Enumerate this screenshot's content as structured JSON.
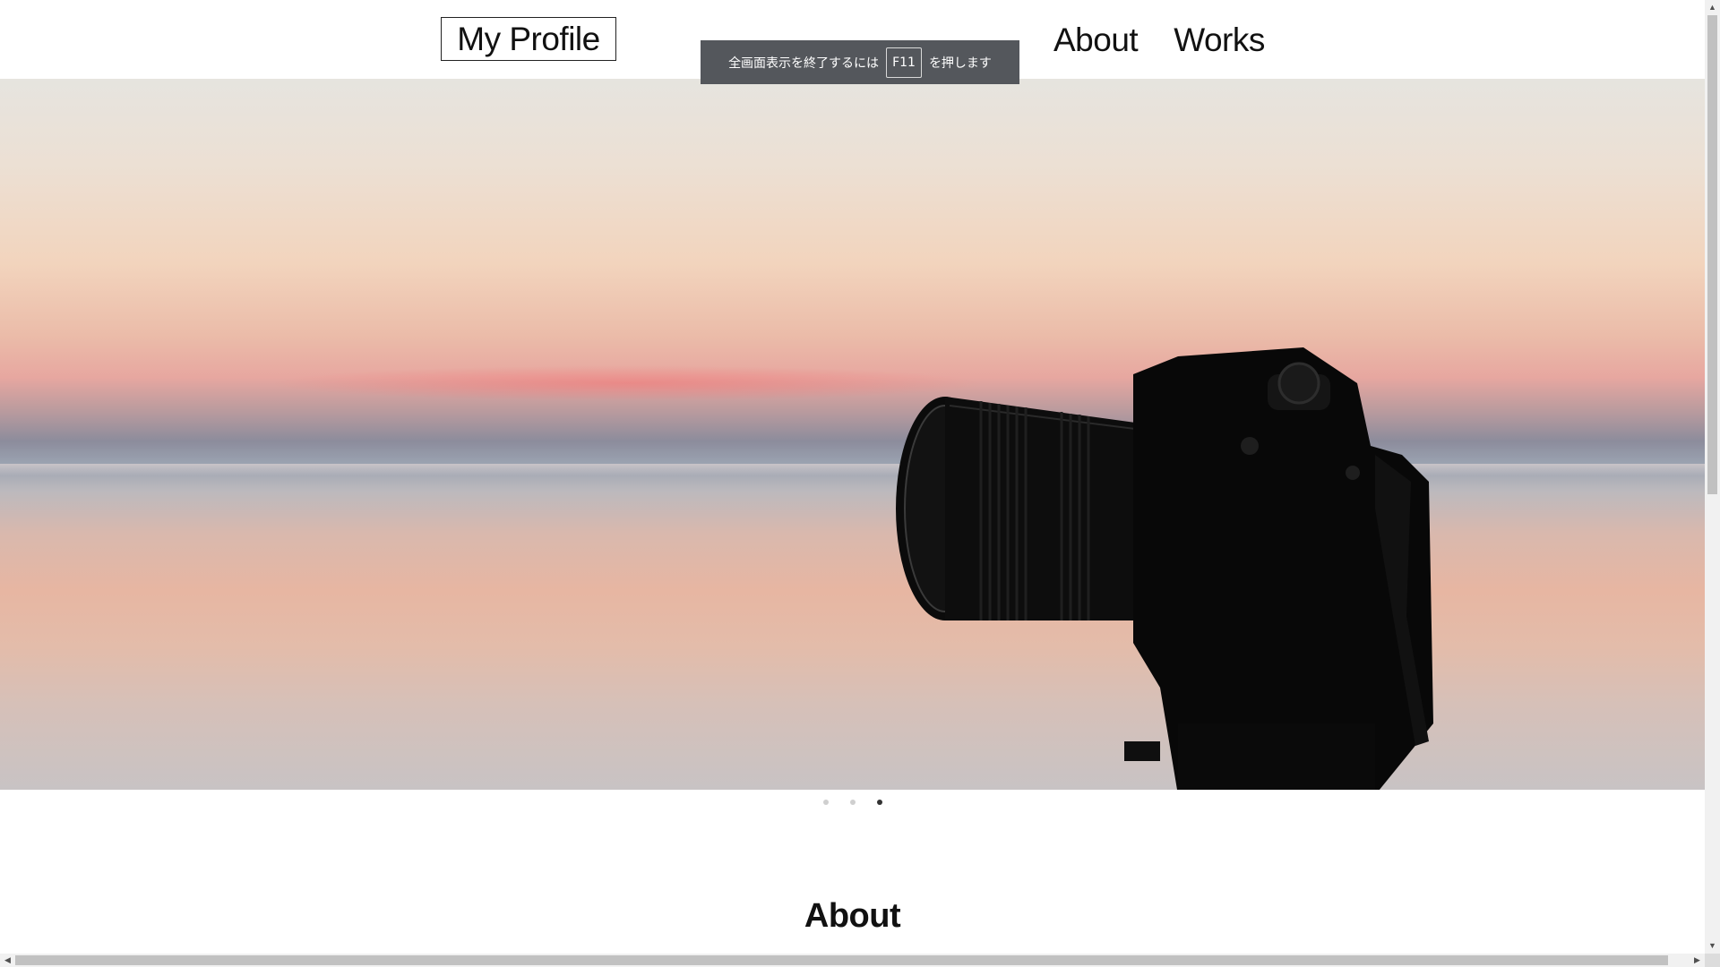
{
  "header": {
    "logo_text": "My Profile",
    "nav": [
      {
        "label": "About"
      },
      {
        "label": "Works"
      }
    ]
  },
  "toast": {
    "prefix": "全画面表示を終了するには",
    "key": "F11",
    "suffix": "を押します"
  },
  "hero": {
    "image_icon": "camera-silhouette",
    "slide_count": 3,
    "active_slide": 3
  },
  "sections": {
    "about_title": "About"
  },
  "colors": {
    "toast_bg": "#54575c",
    "dot_active": "#333333",
    "dot_inactive": "#cfcfcf"
  }
}
